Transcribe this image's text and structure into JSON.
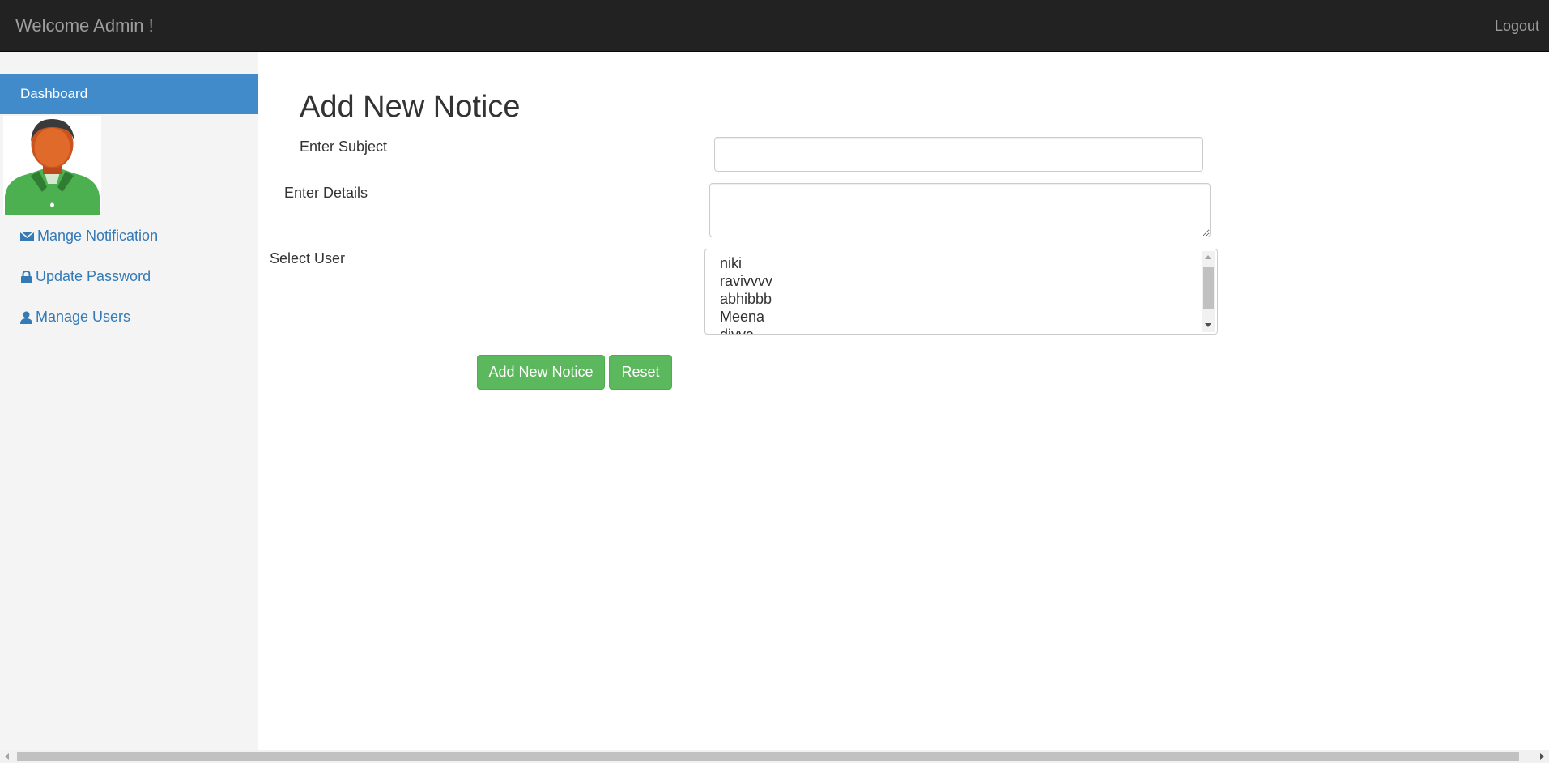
{
  "navbar": {
    "brand": "Welcome Admin !",
    "logout_label": "Logout",
    "background": "#222222"
  },
  "sidebar": {
    "active_item": "Dashboard",
    "active_color": "#428bca",
    "links": [
      {
        "label": "Mange Notification",
        "icon": "envelope-icon"
      },
      {
        "label": "Update Password",
        "icon": "lock-icon"
      },
      {
        "label": "Manage Users",
        "icon": "user-icon"
      }
    ]
  },
  "main": {
    "title": "Add New Notice",
    "subject_label": "Enter Subject",
    "subject_value": "",
    "details_label": "Enter Details",
    "details_value": "",
    "user_label": "Select User",
    "users": [
      "niki",
      "ravivvvv",
      "abhibbb",
      "Meena",
      "divya"
    ],
    "submit_label": "Add New Notice",
    "reset_label": "Reset",
    "button_color": "#5cb85c"
  }
}
